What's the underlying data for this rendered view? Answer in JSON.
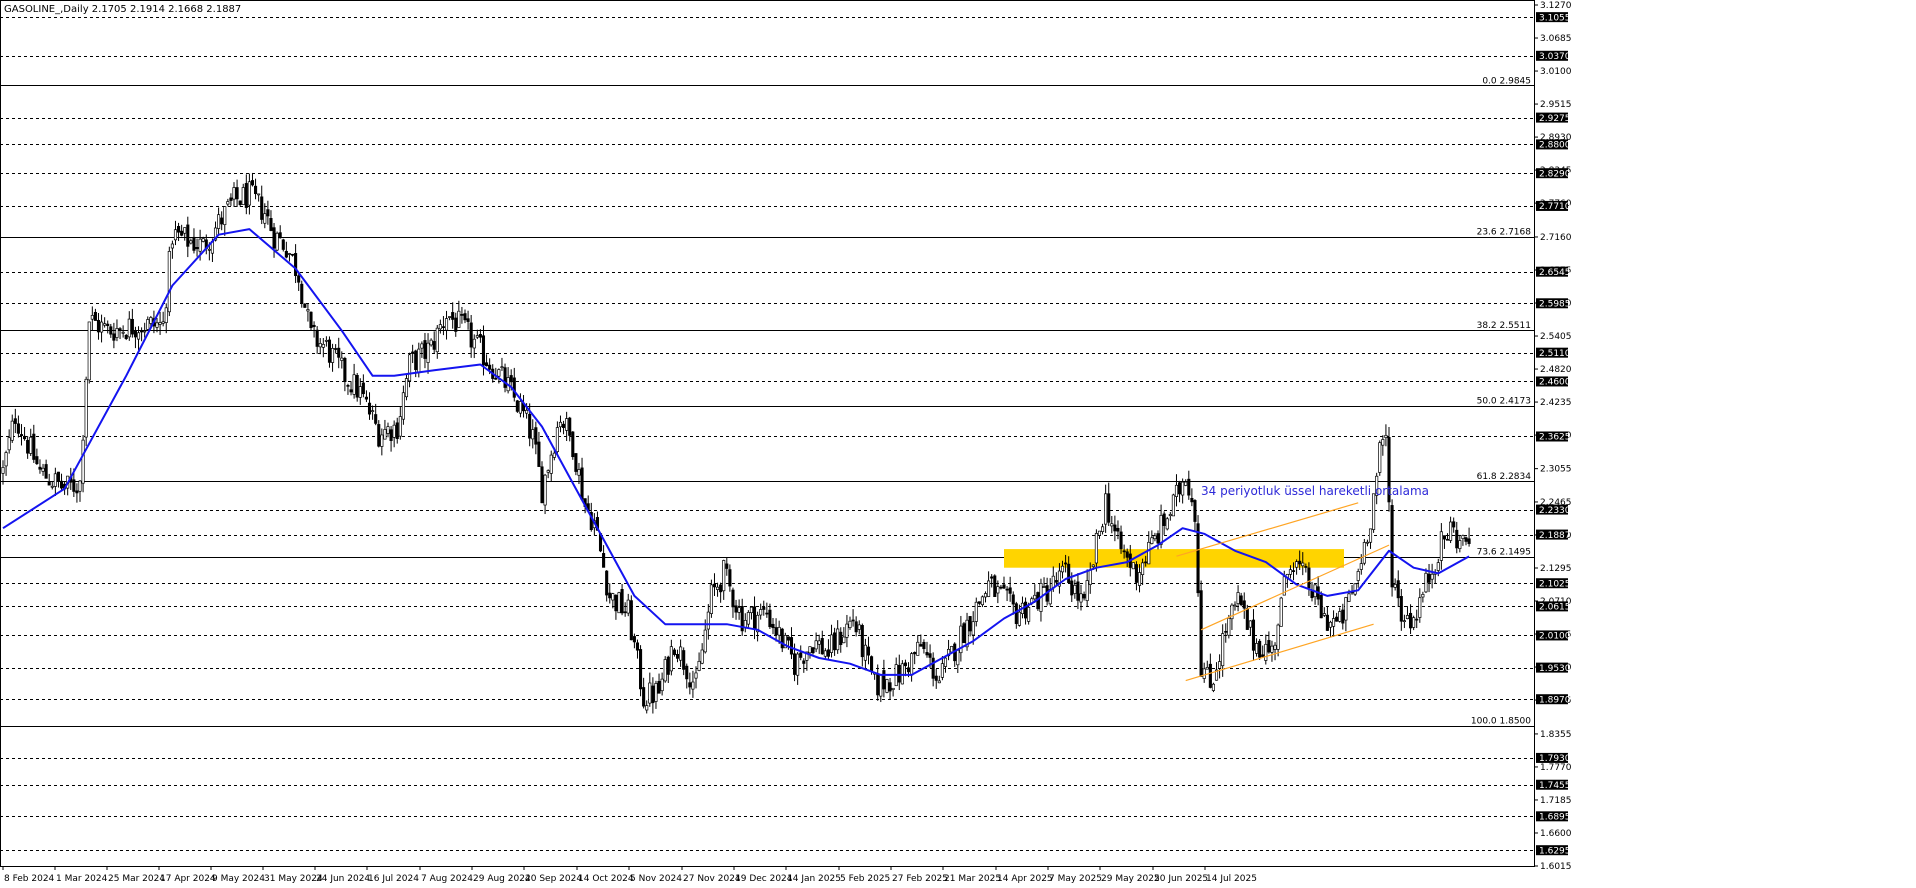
{
  "chart_data": {
    "type": "candlestick",
    "title": "GASOLINE_,Daily  2.1705 2.1914 2.1668 2.1887",
    "ylim": [
      1.6015,
      3.127
    ],
    "y_ticks": [
      "3.1270",
      "3.0685",
      "3.0100",
      "2.9515",
      "2.8930",
      "2.8345",
      "2.7760",
      "2.7160",
      "2.6575",
      "2.5990",
      "2.5405",
      "2.4820",
      "2.4235",
      "2.3650",
      "2.3055",
      "2.2465",
      "2.1880",
      "2.1295",
      "2.0710",
      "2.0125",
      "1.9540",
      "1.8955",
      "1.8355",
      "1.7770",
      "1.7185",
      "1.6600",
      "1.6015"
    ],
    "level_labels": [
      {
        "value": 3.1055,
        "label": "3.1055"
      },
      {
        "value": 3.037,
        "label": "3.0370"
      },
      {
        "value": 2.9275,
        "label": "2.9275"
      },
      {
        "value": 2.88,
        "label": "2.8800"
      },
      {
        "value": 2.829,
        "label": "2.8290"
      },
      {
        "value": 2.771,
        "label": "2.7710"
      },
      {
        "value": 2.6545,
        "label": "2.6545"
      },
      {
        "value": 2.5985,
        "label": "2.5985"
      },
      {
        "value": 2.511,
        "label": "2.5110"
      },
      {
        "value": 2.46,
        "label": "2.4600"
      },
      {
        "value": 2.3625,
        "label": "2.3625"
      },
      {
        "value": 2.233,
        "label": "2.2330"
      },
      {
        "value": 2.1887,
        "label": "2.1887"
      },
      {
        "value": 2.1025,
        "label": "2.1025"
      },
      {
        "value": 2.0615,
        "label": "2.0615"
      },
      {
        "value": 2.01,
        "label": "2.0100"
      },
      {
        "value": 1.953,
        "label": "1.9530"
      },
      {
        "value": 1.897,
        "label": "1.8970"
      },
      {
        "value": 1.793,
        "label": "1.7930"
      },
      {
        "value": 1.7455,
        "label": "1.7455"
      },
      {
        "value": 1.6895,
        "label": "1.6895"
      },
      {
        "value": 1.6295,
        "label": "1.6295"
      }
    ],
    "fib_levels": [
      {
        "value": 2.9845,
        "label": "0.0 2.9845"
      },
      {
        "value": 2.7168,
        "label": "23.6 2.7168"
      },
      {
        "value": 2.5511,
        "label": "38.2 2.5511"
      },
      {
        "value": 2.4173,
        "label": "50.0 2.4173"
      },
      {
        "value": 2.2834,
        "label": "61.8 2.2834"
      },
      {
        "value": 2.1495,
        "label": "73.6 2.1495"
      },
      {
        "value": 1.85,
        "label": "100.0 1.8500"
      }
    ],
    "x_ticks": [
      "8 Feb 2024",
      "1 Mar 2024",
      "25 Mar 2024",
      "17 Apr 2024",
      "9 May 2024",
      "31 May 2024",
      "24 Jun 2024",
      "16 Jul 2024",
      "7 Aug 2024",
      "29 Aug 2024",
      "20 Sep 2024",
      "14 Oct 2024",
      "5 Nov 2024",
      "27 Nov 2024",
      "19 Dec 2024",
      "14 Jan 2025",
      "5 Feb 2025",
      "27 Feb 2025",
      "21 Mar 2025",
      "14 Apr 2025",
      "7 May 2025",
      "29 May 2025",
      "20 Jun 2025",
      "14 Jul 2025"
    ],
    "price_path": [
      [
        0,
        2.3
      ],
      [
        4,
        2.4
      ],
      [
        12,
        2.3
      ],
      [
        20,
        2.27
      ],
      [
        25,
        2.28
      ],
      [
        28,
        2.57
      ],
      [
        34,
        2.55
      ],
      [
        44,
        2.56
      ],
      [
        52,
        2.56
      ],
      [
        55,
        2.72
      ],
      [
        65,
        2.7
      ],
      [
        75,
        2.78
      ],
      [
        80,
        2.79
      ],
      [
        85,
        2.76
      ],
      [
        88,
        2.72
      ],
      [
        92,
        2.7
      ],
      [
        96,
        2.65
      ],
      [
        100,
        2.54
      ],
      [
        105,
        2.52
      ],
      [
        111,
        2.47
      ],
      [
        116,
        2.44
      ],
      [
        122,
        2.37
      ],
      [
        128,
        2.38
      ],
      [
        132,
        2.49
      ],
      [
        139,
        2.52
      ],
      [
        144,
        2.58
      ],
      [
        150,
        2.55
      ],
      [
        157,
        2.5
      ],
      [
        164,
        2.45
      ],
      [
        169,
        2.4
      ],
      [
        172,
        2.36
      ],
      [
        175,
        2.27
      ],
      [
        181,
        2.4
      ],
      [
        185,
        2.35
      ],
      [
        189,
        2.24
      ],
      [
        192,
        2.21
      ],
      [
        197,
        2.08
      ],
      [
        203,
        2.05
      ],
      [
        208,
        1.9
      ],
      [
        213,
        1.91
      ],
      [
        218,
        2.0
      ],
      [
        225,
        1.92
      ],
      [
        230,
        2.08
      ],
      [
        234,
        2.12
      ],
      [
        240,
        2.04
      ],
      [
        248,
        2.05
      ],
      [
        257,
        1.96
      ],
      [
        263,
        2.0
      ],
      [
        268,
        1.98
      ],
      [
        276,
        2.04
      ],
      [
        283,
        1.92
      ],
      [
        291,
        1.94
      ],
      [
        298,
        1.99
      ],
      [
        304,
        1.93
      ],
      [
        310,
        2.0
      ],
      [
        320,
        2.1
      ],
      [
        329,
        2.05
      ],
      [
        337,
        2.08
      ],
      [
        345,
        2.12
      ],
      [
        351,
        2.06
      ],
      [
        358,
        2.25
      ],
      [
        362,
        2.17
      ],
      [
        368,
        2.12
      ],
      [
        374,
        2.18
      ],
      [
        380,
        2.24
      ],
      [
        384,
        2.3
      ],
      [
        387,
        2.23
      ],
      [
        389,
        1.96
      ],
      [
        392,
        1.92
      ],
      [
        397,
        2.02
      ],
      [
        401,
        2.07
      ],
      [
        406,
        2.0
      ],
      [
        412,
        1.98
      ],
      [
        418,
        2.15
      ],
      [
        424,
        2.1
      ],
      [
        429,
        2.04
      ],
      [
        434,
        2.03
      ],
      [
        439,
        2.1
      ],
      [
        444,
        2.22
      ],
      [
        447,
        2.33
      ],
      [
        449,
        2.36
      ],
      [
        451,
        2.12
      ],
      [
        454,
        2.05
      ],
      [
        458,
        2.04
      ],
      [
        462,
        2.1
      ],
      [
        466,
        2.16
      ],
      [
        470,
        2.2
      ],
      [
        474,
        2.17
      ],
      [
        476,
        2.19
      ]
    ],
    "ema_34": [
      [
        0,
        2.2
      ],
      [
        20,
        2.27
      ],
      [
        40,
        2.47
      ],
      [
        55,
        2.63
      ],
      [
        70,
        2.72
      ],
      [
        80,
        2.73
      ],
      [
        95,
        2.66
      ],
      [
        110,
        2.55
      ],
      [
        120,
        2.47
      ],
      [
        127,
        2.47
      ],
      [
        140,
        2.48
      ],
      [
        155,
        2.49
      ],
      [
        165,
        2.45
      ],
      [
        175,
        2.38
      ],
      [
        185,
        2.28
      ],
      [
        195,
        2.18
      ],
      [
        205,
        2.08
      ],
      [
        215,
        2.03
      ],
      [
        225,
        2.03
      ],
      [
        235,
        2.03
      ],
      [
        245,
        2.02
      ],
      [
        255,
        1.99
      ],
      [
        265,
        1.97
      ],
      [
        275,
        1.96
      ],
      [
        285,
        1.94
      ],
      [
        295,
        1.94
      ],
      [
        305,
        1.97
      ],
      [
        315,
        2.0
      ],
      [
        325,
        2.04
      ],
      [
        335,
        2.07
      ],
      [
        345,
        2.11
      ],
      [
        355,
        2.13
      ],
      [
        365,
        2.14
      ],
      [
        375,
        2.17
      ],
      [
        383,
        2.2
      ],
      [
        390,
        2.19
      ],
      [
        400,
        2.16
      ],
      [
        410,
        2.14
      ],
      [
        420,
        2.1
      ],
      [
        430,
        2.08
      ],
      [
        440,
        2.09
      ],
      [
        450,
        2.16
      ],
      [
        458,
        2.13
      ],
      [
        466,
        2.12
      ],
      [
        476,
        2.15
      ]
    ],
    "channel_upper": [
      [
        381,
        2.1505
      ],
      [
        440,
        2.245
      ]
    ],
    "channel_mid": [
      [
        389,
        2.02
      ],
      [
        450,
        2.17
      ]
    ],
    "channel_lower": [
      [
        384,
        1.93
      ],
      [
        445,
        2.03
      ]
    ],
    "zone": {
      "top": 2.163,
      "bottom": 2.13
    },
    "annotation": "34 periyotluk üssel hareketli ortalama",
    "colors": {
      "bull": "#ffffff",
      "bear": "#000000",
      "ema": "#1414f0",
      "channel": "#ffa524",
      "zone": "#ffd400",
      "grid": "#000000"
    }
  }
}
